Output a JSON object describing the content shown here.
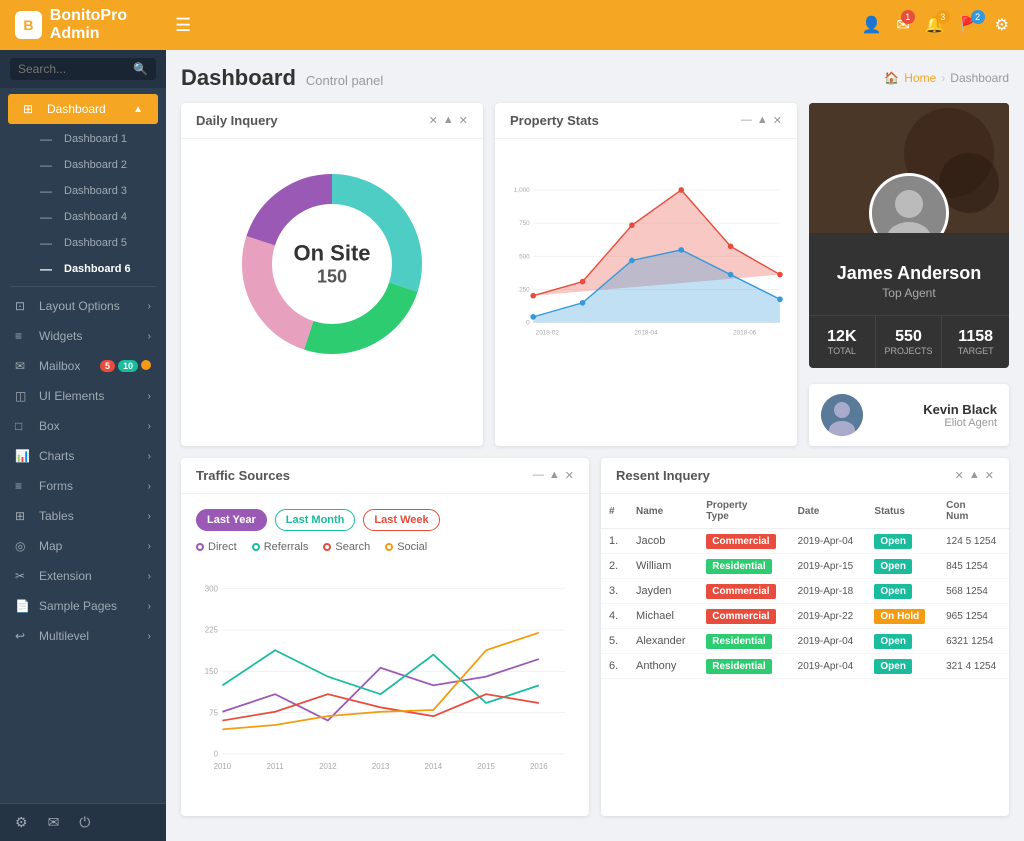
{
  "brand": {
    "icon": "B",
    "name": "BonitoPro",
    "suffix": "Admin"
  },
  "topnav": {
    "hamburger": "☰",
    "icons": [
      "👤",
      "✉",
      "🔔",
      "🚩",
      "⚙"
    ]
  },
  "sidebar": {
    "search_placeholder": "Search...",
    "items": [
      {
        "label": "Dashboard",
        "icon": "⊞",
        "active": true,
        "has_arrow": true
      },
      {
        "label": "Dashboard 1",
        "icon": "—",
        "sub": true
      },
      {
        "label": "Dashboard 2",
        "icon": "—",
        "sub": true
      },
      {
        "label": "Dashboard 3",
        "icon": "—",
        "sub": true
      },
      {
        "label": "Dashboard 4",
        "icon": "—",
        "sub": true
      },
      {
        "label": "Dashboard 5",
        "icon": "—",
        "sub": true
      },
      {
        "label": "Dashboard 6",
        "icon": "—",
        "sub": true,
        "current": true
      },
      {
        "label": "Layout Options",
        "icon": "⊡",
        "has_arrow": true
      },
      {
        "label": "Widgets",
        "icon": "≡",
        "has_arrow": true
      },
      {
        "label": "Mailbox",
        "icon": "✉",
        "has_arrow": false,
        "badges": [
          {
            "val": "5",
            "color": "red"
          },
          {
            "val": "10",
            "color": "teal"
          },
          {
            "val": "",
            "color": "yellow"
          }
        ]
      },
      {
        "label": "UI Elements",
        "icon": "◫",
        "has_arrow": true
      },
      {
        "label": "Box",
        "icon": "□",
        "has_arrow": true
      },
      {
        "label": "Charts",
        "icon": "📊",
        "has_arrow": true
      },
      {
        "label": "Forms",
        "icon": "≡",
        "has_arrow": true
      },
      {
        "label": "Tables",
        "icon": "⊞",
        "has_arrow": true
      },
      {
        "label": "Map",
        "icon": "◎",
        "has_arrow": true
      },
      {
        "label": "Extension",
        "icon": "✂",
        "has_arrow": true
      },
      {
        "label": "Sample Pages",
        "icon": "📄",
        "has_arrow": true
      },
      {
        "label": "Multilevel",
        "icon": "↩",
        "has_arrow": true
      }
    ],
    "footer": [
      "⚙",
      "✉",
      "⏻"
    ]
  },
  "page": {
    "title": "Dashboard",
    "subtitle": "Control panel",
    "breadcrumb": [
      "Home",
      "Dashboard"
    ]
  },
  "daily_inquery": {
    "title": "Daily Inquery",
    "center_label": "On Site",
    "center_value": "150",
    "segments": [
      {
        "label": "Teal",
        "value": 30,
        "color": "#4ecdc4"
      },
      {
        "label": "Green",
        "value": 25,
        "color": "#2ecc71"
      },
      {
        "label": "Pink",
        "value": 25,
        "color": "#e8a0bf"
      },
      {
        "label": "Purple",
        "value": 20,
        "color": "#9b59b6"
      }
    ]
  },
  "property_stats": {
    "title": "Property Stats",
    "y_labels": [
      "1,000",
      "750",
      "500",
      "250",
      "0"
    ],
    "x_labels": [
      "2018-02",
      "2018-04",
      "2018-06"
    ]
  },
  "profile": {
    "name": "James Anderson",
    "role": "Top Agent",
    "stats": [
      {
        "value": "12K",
        "label": "TOTAL"
      },
      {
        "value": "550",
        "label": "PROJECTS"
      },
      {
        "value": "1158",
        "label": "TARGET"
      }
    ]
  },
  "agent": {
    "name": "Kevin Black",
    "role": "Eliot Agent"
  },
  "traffic": {
    "title": "Traffic Sources",
    "filters": [
      {
        "label": "Last Year",
        "style": "active-purple"
      },
      {
        "label": "Last Month",
        "style": "outline-teal"
      },
      {
        "label": "Last Week",
        "style": "outline-red"
      }
    ],
    "legend": [
      {
        "label": "Direct",
        "color": "#9b59b6"
      },
      {
        "label": "Referrals",
        "color": "#1abc9c"
      },
      {
        "label": "Search",
        "color": "#e74c3c"
      },
      {
        "label": "Social",
        "color": "#f39c12"
      }
    ],
    "y_labels": [
      "300",
      "225",
      "150",
      "75",
      "0"
    ],
    "x_labels": [
      "2010",
      "2011",
      "2012",
      "2013",
      "2014",
      "2015",
      "2016"
    ]
  },
  "recent_inquery": {
    "title": "Resent Inquery",
    "columns": [
      "#",
      "Name",
      "Property Type",
      "Date",
      "Status",
      "Con Num"
    ],
    "rows": [
      {
        "num": "1.",
        "name": "Jacob",
        "type": "Commercial",
        "type_class": "commercial",
        "date": "2019-Apr-04",
        "status": "Open",
        "status_class": "open",
        "contact": "124 5 1254"
      },
      {
        "num": "2.",
        "name": "William",
        "type": "Residential",
        "type_class": "residential",
        "date": "2019-Apr-15",
        "status": "Open",
        "status_class": "open",
        "contact": "845 1254"
      },
      {
        "num": "3.",
        "name": "Jayden",
        "type": "Commercial",
        "type_class": "commercial",
        "date": "2019-Apr-18",
        "status": "Open",
        "status_class": "open",
        "contact": "568 1254"
      },
      {
        "num": "4.",
        "name": "Michael",
        "type": "Commercial",
        "type_class": "commercial",
        "date": "2019-Apr-22",
        "status": "On Hold",
        "status_class": "hold",
        "contact": "965 1254"
      },
      {
        "num": "5.",
        "name": "Alexander",
        "type": "Residential",
        "type_class": "residential",
        "date": "2019-Apr-04",
        "status": "Open",
        "status_class": "open",
        "contact": "6321 1254"
      },
      {
        "num": "6.",
        "name": "Anthony",
        "type": "Residential",
        "type_class": "residential",
        "date": "2019-Apr-04",
        "status": "Open",
        "status_class": "open",
        "contact": "321 4 1254"
      }
    ]
  }
}
